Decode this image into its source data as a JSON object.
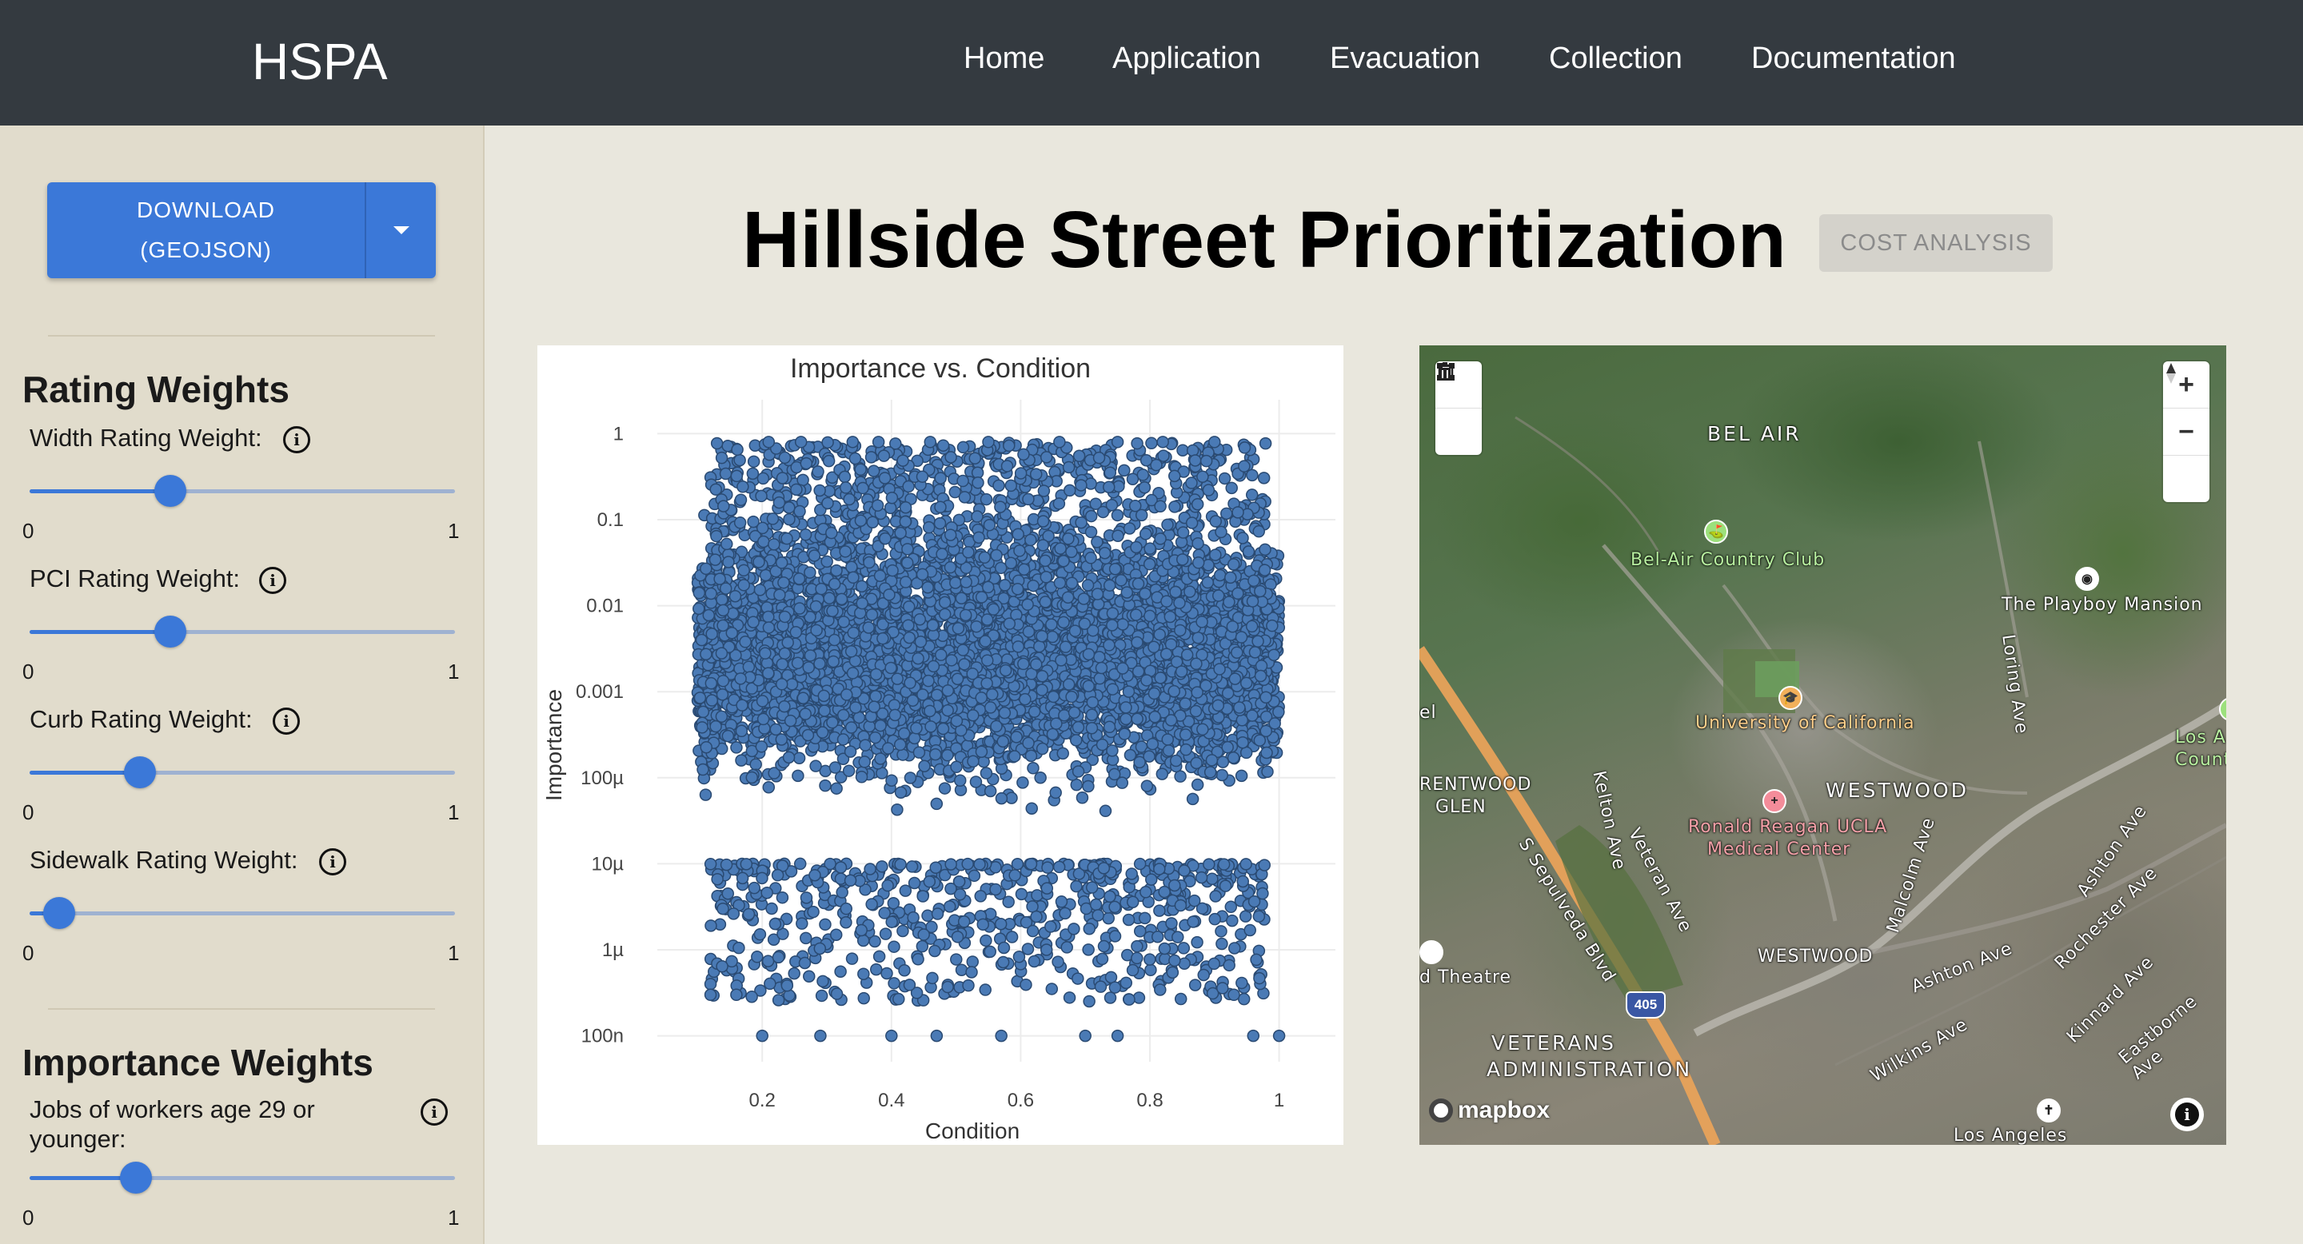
{
  "nav": {
    "brand": "HSPA",
    "links": [
      "Home",
      "Application",
      "Evacuation",
      "Collection",
      "Documentation"
    ]
  },
  "sidebar": {
    "download_line1": "DOWNLOAD",
    "download_line2": "(GEOJSON)",
    "rating_title": "Rating Weights",
    "rating_sliders": [
      {
        "label": "Width Rating Weight:",
        "value": 0.33,
        "min": "0",
        "max": "1"
      },
      {
        "label": "PCI Rating Weight:",
        "value": 0.33,
        "min": "0",
        "max": "1"
      },
      {
        "label": "Curb Rating Weight:",
        "value": 0.26,
        "min": "0",
        "max": "1"
      },
      {
        "label": "Sidewalk Rating Weight:",
        "value": 0.01,
        "min": "0",
        "max": "1"
      }
    ],
    "importance_title": "Importance Weights",
    "importance_sliders": [
      {
        "label_line1": "Jobs of workers age 29 or",
        "label_line2": "younger:",
        "value": 0.25,
        "min": "0",
        "max": "1"
      }
    ]
  },
  "main": {
    "title": "Hillside Street Prioritization",
    "cost_button": "COST ANALYSIS"
  },
  "chart_data": {
    "type": "scatter",
    "title": "Importance vs. Condition",
    "xlabel": "Condition",
    "ylabel": "Importance",
    "xlim": [
      0.05,
      1.05
    ],
    "ylim": [
      5e-08,
      2
    ],
    "y_scale": "log",
    "x_ticks": [
      "0.2",
      "0.4",
      "0.6",
      "0.8",
      "1"
    ],
    "y_ticks": [
      "1",
      "0.1",
      "0.01",
      "0.001",
      "100µ",
      "10µ",
      "1µ",
      "100n"
    ],
    "marker_color": "#4a7ab5",
    "dense_region": {
      "x": [
        0.1,
        1.0
      ],
      "y": [
        0.0005,
        0.02
      ],
      "approx_points": 20000
    },
    "points": [
      {
        "x": 0.21,
        "y": 0.8
      },
      {
        "x": 0.26,
        "y": 0.8
      },
      {
        "x": 0.34,
        "y": 0.8
      },
      {
        "x": 0.38,
        "y": 0.8
      },
      {
        "x": 0.46,
        "y": 0.8
      },
      {
        "x": 0.55,
        "y": 0.8
      },
      {
        "x": 0.66,
        "y": 0.8
      },
      {
        "x": 0.75,
        "y": 0.8
      },
      {
        "x": 0.82,
        "y": 0.8
      },
      {
        "x": 0.9,
        "y": 0.8
      },
      {
        "x": 0.2,
        "y": 1e-07
      },
      {
        "x": 0.29,
        "y": 1e-07
      },
      {
        "x": 0.4,
        "y": 1e-07
      },
      {
        "x": 0.47,
        "y": 1e-07
      },
      {
        "x": 0.57,
        "y": 1e-07
      },
      {
        "x": 0.7,
        "y": 1e-07
      },
      {
        "x": 0.75,
        "y": 1e-07
      },
      {
        "x": 0.96,
        "y": 1e-07
      },
      {
        "x": 1.0,
        "y": 1e-07
      },
      {
        "x": 0.12,
        "y": 4e-07
      },
      {
        "x": 0.12,
        "y": 3e-07
      },
      {
        "x": 0.16,
        "y": 3e-07
      },
      {
        "x": 0.22,
        "y": 2e-06
      },
      {
        "x": 0.33,
        "y": 3e-06
      },
      {
        "x": 0.45,
        "y": 1.5e-06
      },
      {
        "x": 0.64,
        "y": 1e-06
      },
      {
        "x": 0.78,
        "y": 8e-07
      },
      {
        "x": 0.93,
        "y": 3e-07
      }
    ]
  },
  "map": {
    "labels": {
      "belair": "BEL AIR",
      "country_club": "Bel-Air Country Club",
      "playboy": "The Playboy Mansion",
      "ucla": "University of California",
      "brentwood1": "RENTWOOD",
      "brentwood2": "GLEN",
      "westwood": "WESTWOOD",
      "westwood2": "WESTWOOD",
      "ronald1": "Ronald Reagan UCLA",
      "ronald2": "Medical Center",
      "veterans1": "VETERANS",
      "veterans2": "ADMINISTRATION",
      "theatre": "d Theatre",
      "los_angeles": "Los Angeles",
      "los_a": "Los A",
      "count": "Count",
      "kelton": "Kelton Ave",
      "veteran": "Veteran Ave",
      "sepulveda": "S Sepulveda Blvd",
      "malcolm": "Malcolm Ave",
      "loring": "Loring Ave",
      "ashton": "Ashton Ave",
      "ashton2": "Ashton Ave",
      "rochester": "Rochester Ave",
      "kinnard": "Kinnard Ave",
      "eastborne": "Eastborne Ave",
      "wilkins": "Wilkins Ave",
      "freeway": "405",
      "e_label": "el"
    },
    "logo": "mapbox"
  }
}
